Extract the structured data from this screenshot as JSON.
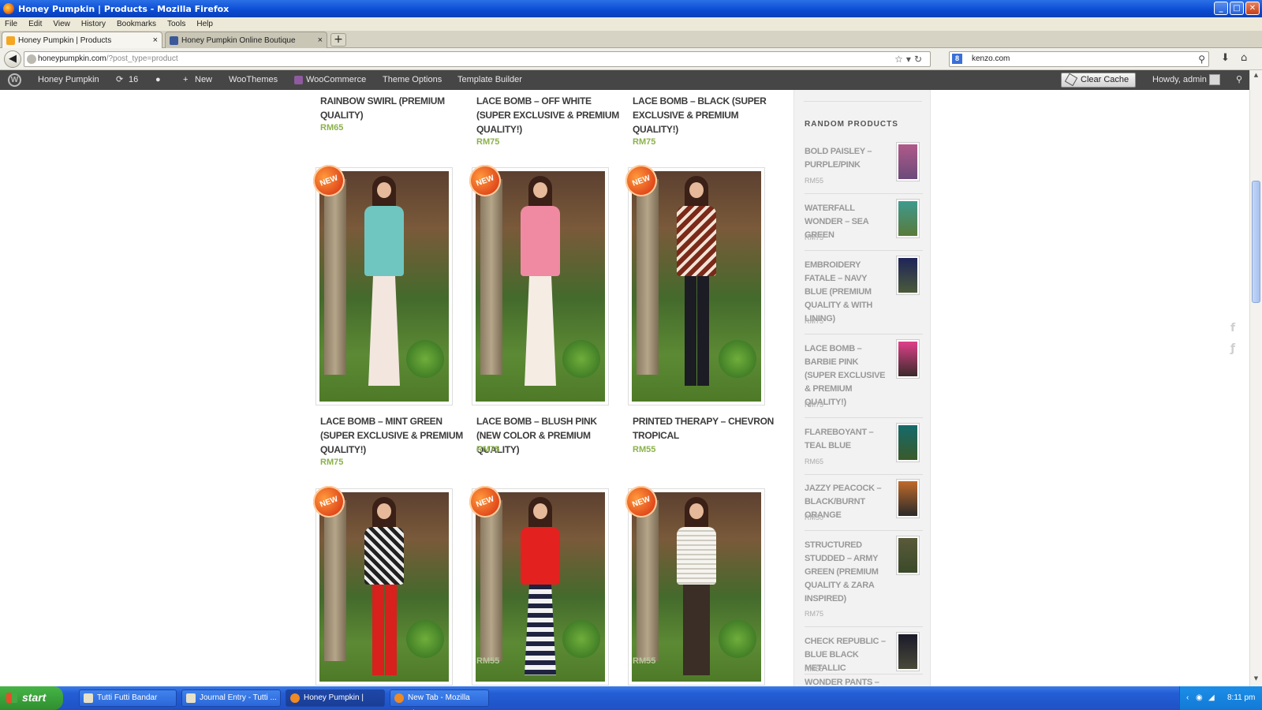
{
  "window": {
    "title": "Honey Pumpkin | Products - Mozilla Firefox",
    "minimize": "_",
    "maximize": "□",
    "close": "✕"
  },
  "menu": [
    "File",
    "Edit",
    "View",
    "History",
    "Bookmarks",
    "Tools",
    "Help"
  ],
  "tabs": [
    {
      "label": "Honey Pumpkin | Products",
      "close": "×"
    },
    {
      "label": "Honey Pumpkin Online Boutique",
      "close": "×"
    }
  ],
  "new_tab": "+",
  "nav": {
    "url_domain": "honeypumpkin.com",
    "url_path": "/?post_type=product",
    "search_value": "kenzo.com",
    "search_engine_glyph": "8"
  },
  "adminbar": {
    "site_name": "Honey Pumpkin",
    "updates_count": "16",
    "new_label": "New",
    "woothemes": "WooThemes",
    "woocommerce": "WooCommerce",
    "theme_options": "Theme Options",
    "template_builder": "Template Builder",
    "clear_cache": "Clear Cache",
    "howdy": "Howdy, admin"
  },
  "products_top": [
    {
      "title": "RAINBOW SWIRL (PREMIUM QUALITY)",
      "price": "RM65"
    },
    {
      "title": "LACE BOMB – OFF WHITE (SUPER EXCLUSIVE & PREMIUM QUALITY!)",
      "price": "RM75"
    },
    {
      "title": "LACE BOMB – BLACK (SUPER EXCLUSIVE & PREMIUM QUALITY!)",
      "price": "RM75"
    }
  ],
  "products_mid": [
    {
      "title": "LACE BOMB – MINT GREEN (SUPER EXCLUSIVE & PREMIUM QUALITY!)",
      "price": "RM75",
      "badge": "NEW"
    },
    {
      "title": "LACE BOMB – BLUSH PINK (NEW COLOR & PREMIUM QUALITY)",
      "price": "RM75",
      "badge": "NEW"
    },
    {
      "title": "PRINTED THERAPY – CHEVRON TROPICAL",
      "price": "RM55",
      "badge": "NEW"
    }
  ],
  "products_bottom": [
    {
      "badge": "NEW",
      "price": ""
    },
    {
      "badge": "NEW",
      "price": "RM55"
    },
    {
      "badge": "NEW",
      "price": "RM55"
    }
  ],
  "sidebar": {
    "heading": "RANDOM PRODUCTS",
    "items": [
      {
        "name": "BOLD PAISLEY – PURPLE/PINK",
        "price": "RM55"
      },
      {
        "name": "WATERFALL WONDER – SEA GREEN",
        "price": "RM75"
      },
      {
        "name": "EMBROIDERY FATALE – NAVY BLUE (PREMIUM QUALITY & WITH LINING)",
        "price": "RM75"
      },
      {
        "name": "LACE BOMB – BARBIE PINK (SUPER EXCLUSIVE & PREMIUM QUALITY!)",
        "price": "RM75"
      },
      {
        "name": "FLAREBOYANT – TEAL BLUE",
        "price": "RM65"
      },
      {
        "name": "JAZZY PEACOCK – BLACK/BURNT ORANGE",
        "price": "RM50"
      },
      {
        "name": "STRUCTURED STUDDED – ARMY GREEN (PREMIUM QUALITY & ZARA INSPIRED)",
        "price": "RM75"
      },
      {
        "name": "CHECK REPUBLIC – BLUE BLACK METALLIC",
        "price": "RM55"
      },
      {
        "name": "WONDER PANTS –",
        "price": ""
      }
    ]
  },
  "taskbar": {
    "start": "start",
    "tasks": [
      "Tutti Futti Bandar Bot...",
      "Journal Entry - Tutti ...",
      "Honey Pumpkin | Pro...",
      "New Tab - Mozilla Fire..."
    ],
    "clock": "8:11 pm"
  },
  "colors": {
    "price_green": "#8bb24b",
    "adminbar_bg": "#464646",
    "badge_orange": "#e0461a"
  }
}
